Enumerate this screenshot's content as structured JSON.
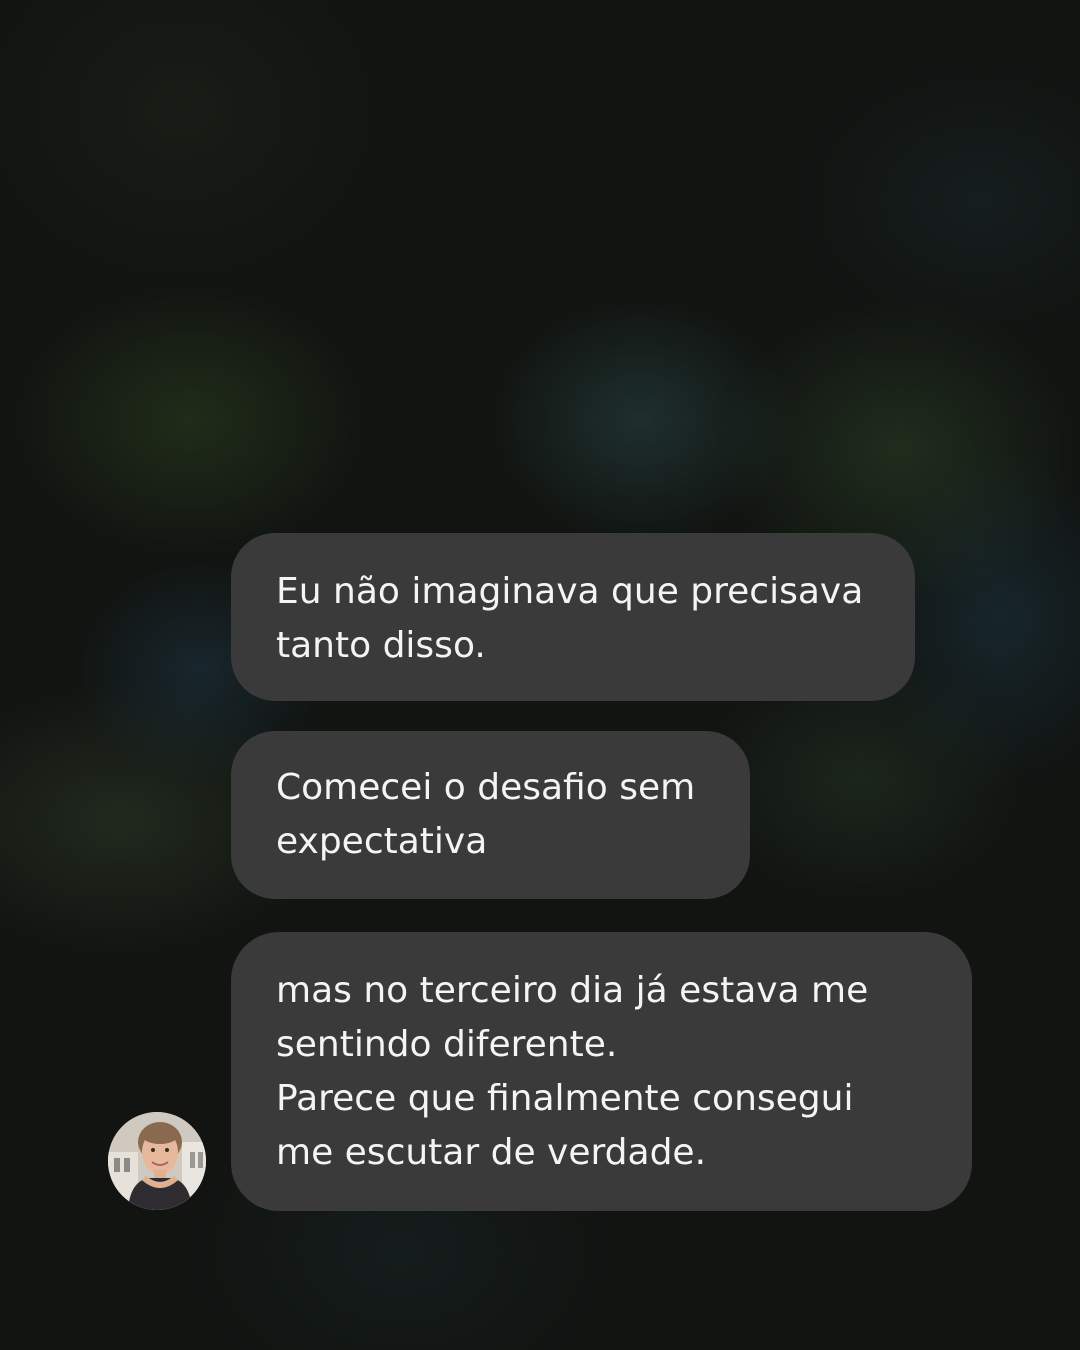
{
  "conversation": {
    "messages": [
      {
        "text": "Eu não imaginava que precisava\ntanto disso."
      },
      {
        "text": "Comecei o desafio sem\nexpectativa"
      },
      {
        "text": "mas no terceiro dia já estava me\nsentindo diferente.\nParece que finalmente consegui\nme escutar de verdade."
      }
    ],
    "avatar": {
      "icon": "user-avatar-photo"
    }
  },
  "colors": {
    "bubble": "#3a3a3a",
    "text": "#f4f4f4",
    "background": "#111411"
  }
}
